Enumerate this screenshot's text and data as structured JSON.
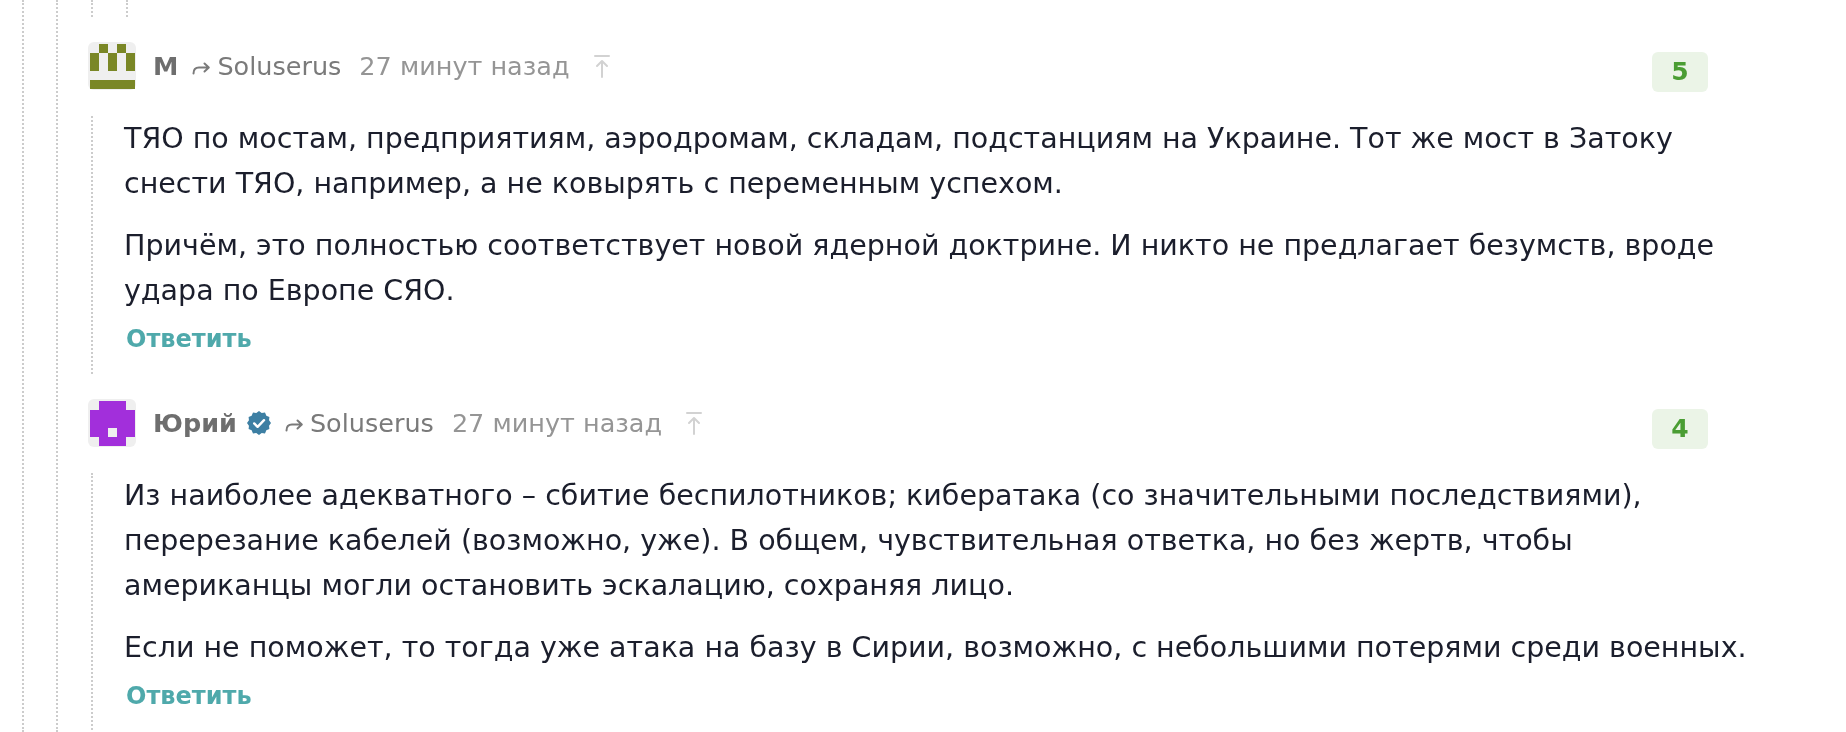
{
  "comments": [
    {
      "author": "M",
      "avatar": {
        "color": "#7a8726"
      },
      "verified": false,
      "reply_to": "Soluserus",
      "time": "27 минут назад",
      "score": "5",
      "paragraphs": [
        "ТЯО по мостам, предприятиям, аэродромам, складам, подстанциям на Украине. Тот же мост в Затоку снести ТЯО, например, а не ковырять с переменным успехом.",
        "Причём, это полностью соответствует новой ядерной доктрине. И никто не предлагает безумств, вроде удара по Европе СЯО."
      ],
      "reply_label": "Ответить"
    },
    {
      "author": "Юрий",
      "avatar": {
        "color": "#a22fdb"
      },
      "verified": true,
      "reply_to": "Soluserus",
      "time": "27 минут назад",
      "score": "4",
      "paragraphs": [
        "Из наиболее адекватного – сбитие беспилотников; кибератака (со значительными последствиями), перерезание кабелей (возможно, уже). В общем, чувствительная ответка, но без жертв, чтобы\nамериканцы могли остановить эскалацию, сохраняя лицо.",
        "Если не поможет, то тогда уже атака на базу в Сирии, возможно, с небольшими потерями среди военных."
      ],
      "reply_label": "Ответить"
    }
  ]
}
